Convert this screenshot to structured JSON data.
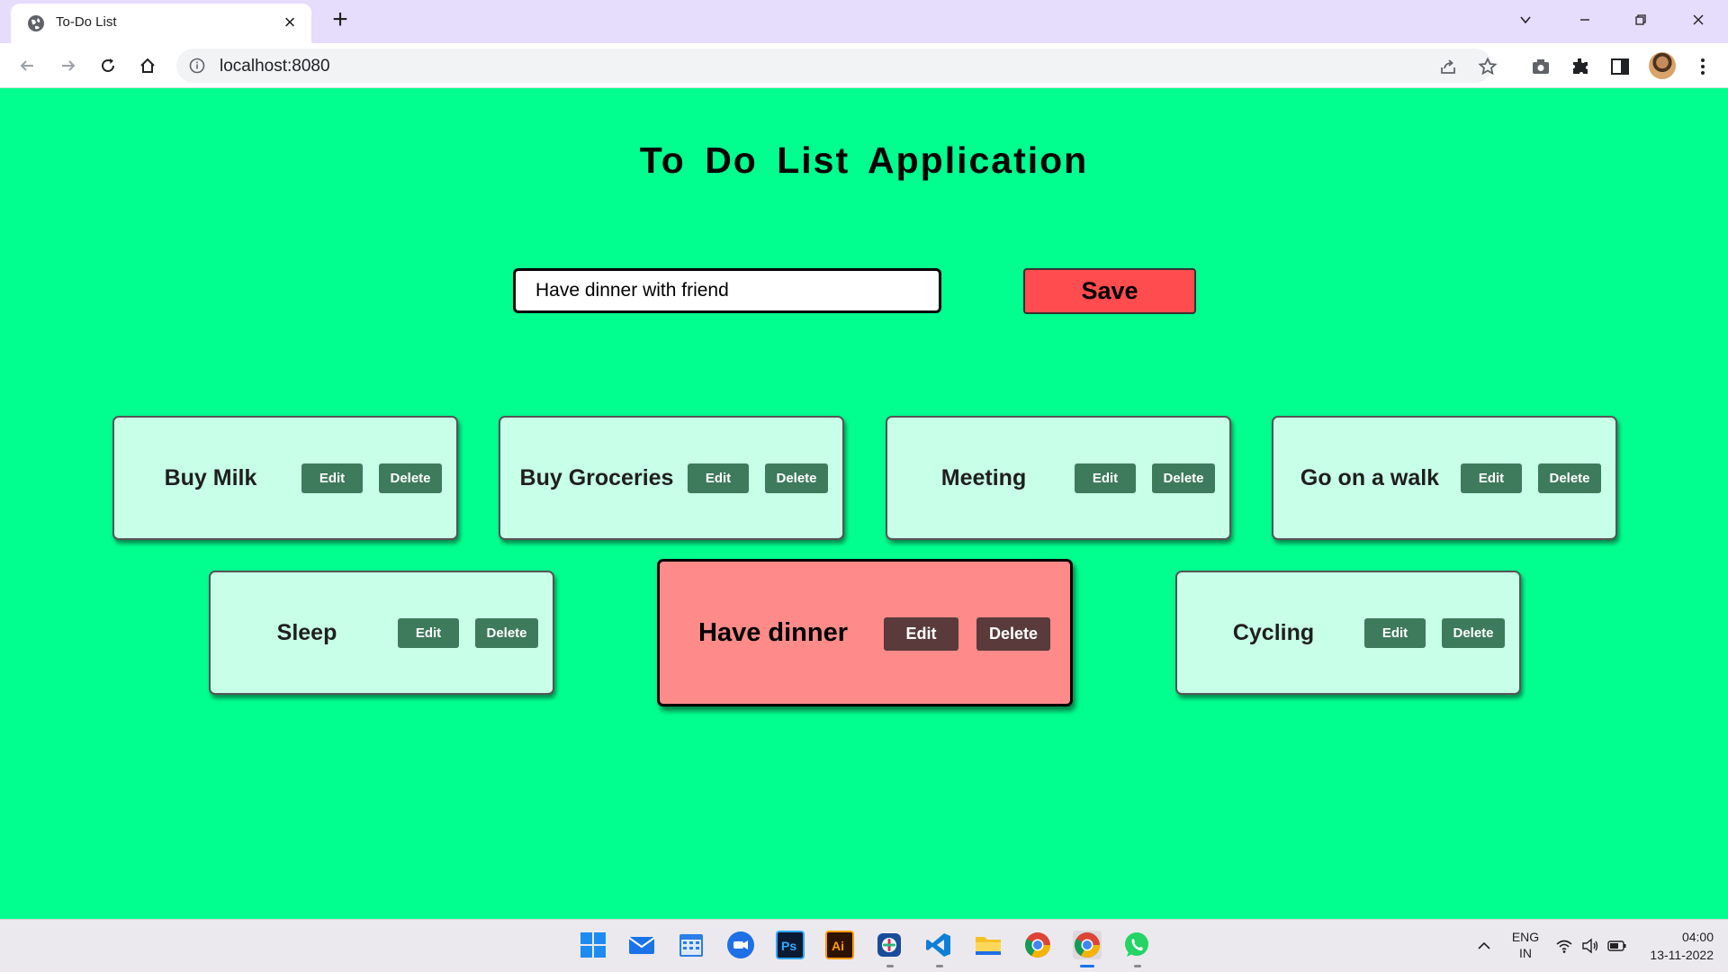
{
  "browser": {
    "tab_title": "To-Do List",
    "url": "localhost:8080"
  },
  "app": {
    "title": "To Do List Application",
    "input_value": "Have dinner with friend",
    "save_label": "Save",
    "tasks": [
      {
        "label": "Buy Milk",
        "edit": "Edit",
        "delete": "Delete",
        "active": false
      },
      {
        "label": "Buy Groceries",
        "edit": "Edit",
        "delete": "Delete",
        "active": false
      },
      {
        "label": "Meeting",
        "edit": "Edit",
        "delete": "Delete",
        "active": false
      },
      {
        "label": "Go on a walk",
        "edit": "Edit",
        "delete": "Delete",
        "active": false
      },
      {
        "label": "Sleep",
        "edit": "Edit",
        "delete": "Delete",
        "active": false
      },
      {
        "label": "Have dinner",
        "edit": "Edit",
        "delete": "Delete",
        "active": true
      },
      {
        "label": "Cycling",
        "edit": "Edit",
        "delete": "Delete",
        "active": false
      }
    ]
  },
  "taskbar": {
    "apps": [
      "start-icon",
      "mail-icon",
      "calendar-icon",
      "zoom-icon",
      "photoshop-icon",
      "illustrator-icon",
      "slack-icon",
      "vscode-icon",
      "file-explorer-icon",
      "chrome-icon",
      "chrome-icon",
      "whatsapp-icon"
    ],
    "lang_top": "ENG",
    "lang_bottom": "IN",
    "time": "04:00",
    "date": "13-11-2022"
  },
  "colors": {
    "page_bg": "#00ff8f",
    "card_bg": "#c8ffe8",
    "card_button": "#3e7a5c",
    "active_card_bg": "#ff8a8a",
    "active_card_button": "#5a3a3a",
    "save_button": "#ff4d4f"
  }
}
